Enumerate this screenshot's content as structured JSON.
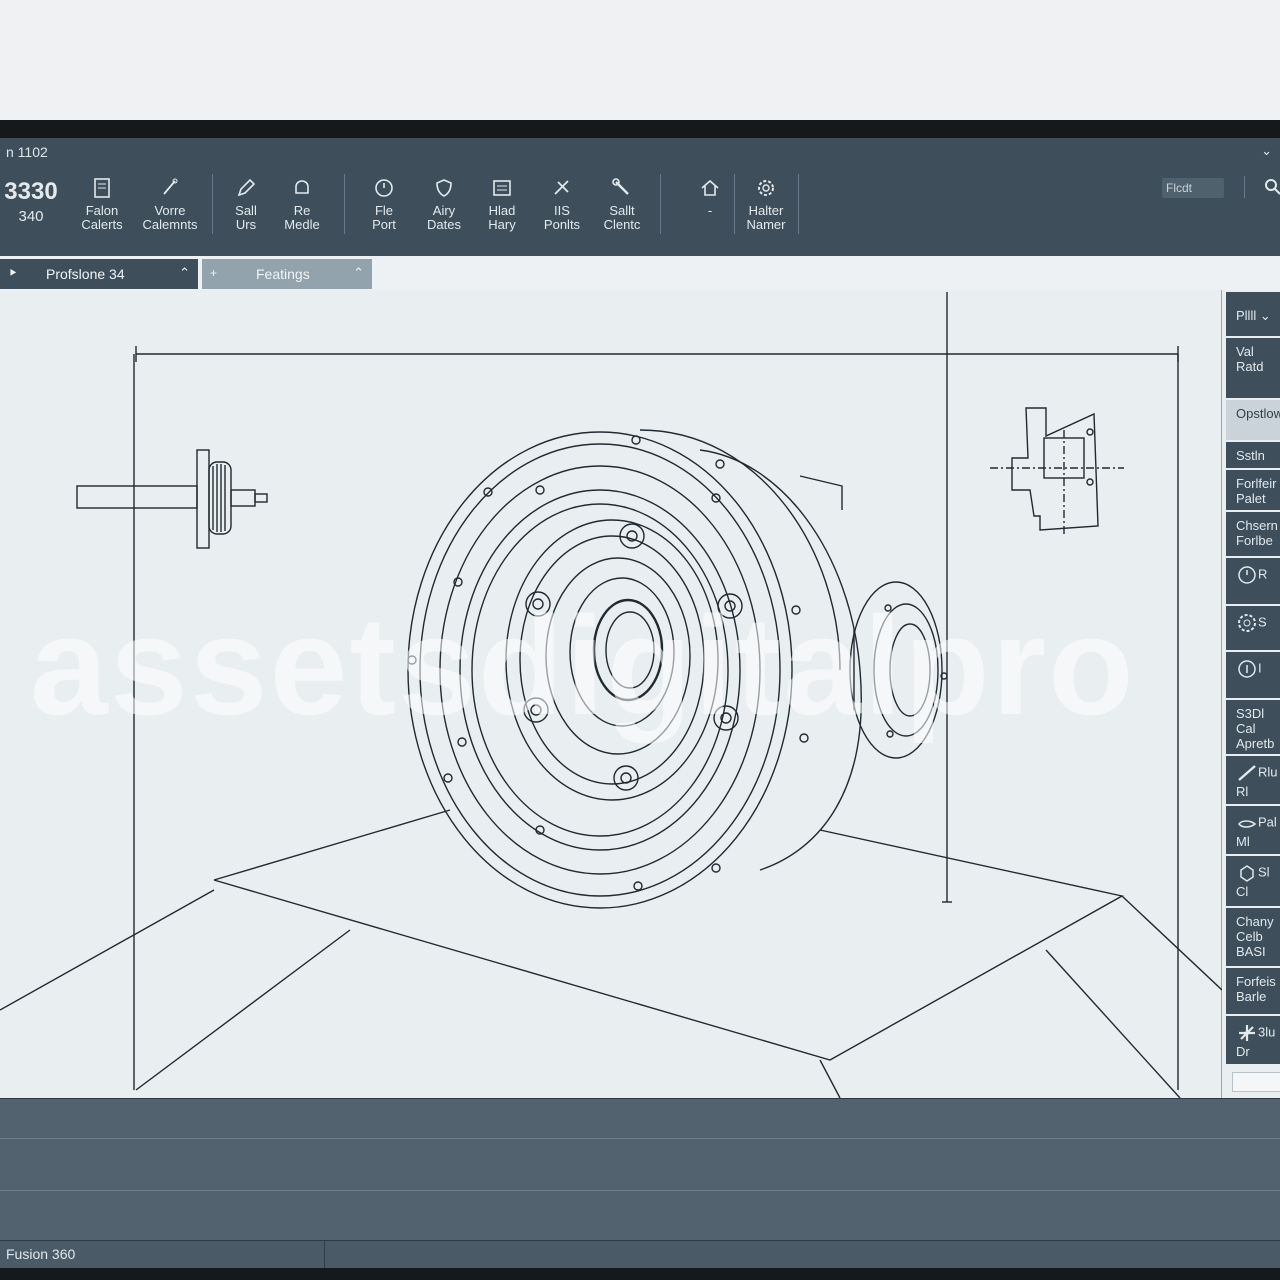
{
  "window": {
    "title": "n 1102",
    "control": "⌄"
  },
  "brand": {
    "line1": "3330",
    "line2": "340"
  },
  "toolbar": {
    "tools": [
      {
        "label1": "Falon",
        "label2": "Calerts",
        "icon": "document-icon"
      },
      {
        "label1": "Vorre",
        "label2": "Calemnts",
        "icon": "pen-icon"
      },
      {
        "label1": "Sall",
        "label2": "Urs",
        "icon": "pencil-icon"
      },
      {
        "label1": "Re",
        "label2": "Medle",
        "icon": "bell-icon"
      },
      {
        "label1": "Fle",
        "label2": "Port",
        "icon": "clock-icon"
      },
      {
        "label1": "Airy",
        "label2": "Dates",
        "icon": "shield-icon"
      },
      {
        "label1": "Hlad",
        "label2": "Hary",
        "icon": "image-icon"
      },
      {
        "label1": "IIS",
        "label2": "Ponlts",
        "icon": "tools-icon"
      },
      {
        "label1": "Sallt",
        "label2": "Clentc",
        "icon": "wrench-icon"
      },
      {
        "label1": "",
        "label2": "-",
        "icon": "home-icon"
      },
      {
        "label1": "Halter",
        "label2": "Namer",
        "icon": "gear-icon"
      }
    ],
    "search_placeholder": "Flcdt"
  },
  "tabs": [
    {
      "prefix": "⯈",
      "label": "Profslone 34",
      "chevron": "⌃"
    },
    {
      "prefix": "+",
      "label": "Featings",
      "chevron": "⌃"
    }
  ],
  "right_panel": {
    "header": "Pllll ⌄",
    "items": [
      {
        "text": "Val\nRatd",
        "icon": ""
      },
      {
        "text": "Opstlow",
        "icon": ""
      },
      {
        "text": "Sstln",
        "icon": ""
      },
      {
        "text": "Forlfeir\nPalet",
        "icon": ""
      },
      {
        "text": "Chsern\nForlbe",
        "icon": ""
      },
      {
        "text": "R",
        "icon": "timer-icon"
      },
      {
        "text": "S",
        "icon": "settings-icon"
      },
      {
        "text": "I",
        "icon": "info-icon"
      },
      {
        "text": "S3Dl\nCal\nApretb",
        "icon": ""
      },
      {
        "text": "Rlu\nRl",
        "icon": "ruler-icon"
      },
      {
        "text": "Pal\nMl",
        "icon": "hand-icon"
      },
      {
        "text": "Sl\nCl",
        "icon": "cube-icon"
      },
      {
        "text": "Chany\nCelb\nBASI",
        "icon": ""
      },
      {
        "text": "Forfeis\nBarle",
        "icon": ""
      },
      {
        "text": "3lu\nDr",
        "icon": "fan-icon"
      }
    ]
  },
  "watermark": "assetsdigitalpro",
  "statusbar": {
    "app_name": "Fusion 360"
  },
  "colors": {
    "toolbar": "#3e4f5b",
    "canvas": "#e9eef1",
    "line": "#1f2a31"
  }
}
